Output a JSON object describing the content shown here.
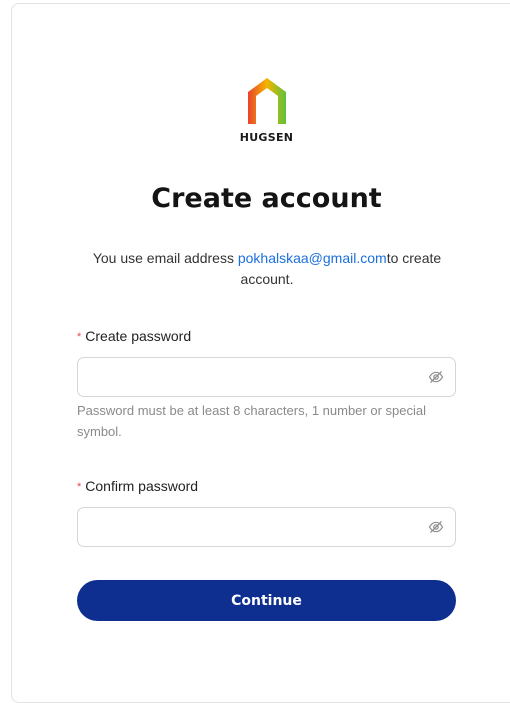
{
  "brand": {
    "name": "HUGSEN",
    "logo_icon": "house-outline-gradient-icon",
    "gradient_colors": [
      "#e8442e",
      "#f5b400",
      "#5cc23a"
    ]
  },
  "title": "Create account",
  "subtitle": {
    "prefix": "You use email address ",
    "email": "pokhalskaa@gmail.com",
    "suffix": "to create account."
  },
  "fields": {
    "create_password": {
      "required_mark": "*",
      "label": "Create password",
      "value": "",
      "toggle_icon": "eye-off-icon"
    },
    "confirm_password": {
      "required_mark": "*",
      "label": "Confirm password",
      "value": "",
      "toggle_icon": "eye-off-icon"
    }
  },
  "password_hint": "Password must be at least 8 characters, 1 number or special symbol.",
  "continue_label": "Continue",
  "colors": {
    "accent": "#0e2f8f",
    "link": "#1b6fdc",
    "required": "#e5484d"
  }
}
